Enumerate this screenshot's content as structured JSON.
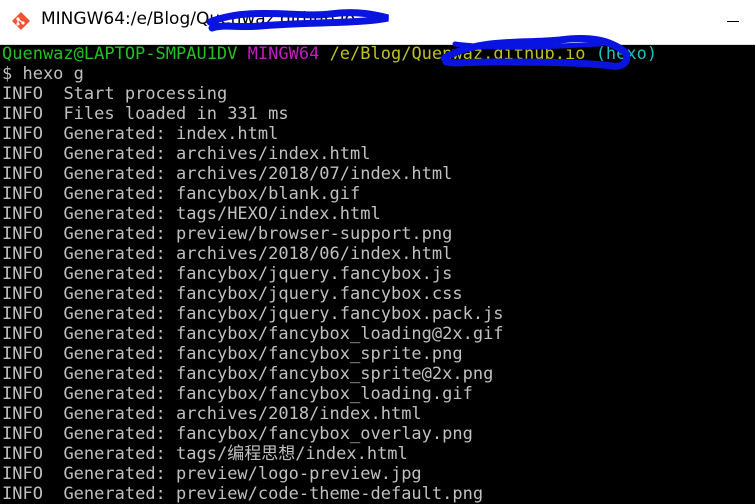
{
  "window": {
    "title": "MINGW64:/e/Blog/Quenwaz.github.io",
    "app_icon": "git-bash-icon",
    "minimize_icon": "minimize-icon"
  },
  "colors": {
    "background": "#000000",
    "prompt_user": "#21c11f",
    "prompt_env": "#c11bc1",
    "prompt_path": "#c0c021",
    "prompt_branch": "#21c0c0",
    "output_text": "#c0c0c0",
    "redaction": "#0a14e0"
  },
  "prompt": {
    "user_host": "Quenwaz@LAPTOP-SMPAU1DV",
    "env": "MINGW64",
    "path": "/e/Blog/Quenwaz.github.io",
    "branch": "(hexo)"
  },
  "command": "$ hexo g",
  "log": [
    {
      "level": "INFO",
      "message": "Start processing"
    },
    {
      "level": "INFO",
      "message": "Files loaded in 331 ms"
    },
    {
      "level": "INFO",
      "message": "Generated: index.html"
    },
    {
      "level": "INFO",
      "message": "Generated: archives/index.html"
    },
    {
      "level": "INFO",
      "message": "Generated: archives/2018/07/index.html"
    },
    {
      "level": "INFO",
      "message": "Generated: fancybox/blank.gif"
    },
    {
      "level": "INFO",
      "message": "Generated: tags/HEXO/index.html"
    },
    {
      "level": "INFO",
      "message": "Generated: preview/browser-support.png"
    },
    {
      "level": "INFO",
      "message": "Generated: archives/2018/06/index.html"
    },
    {
      "level": "INFO",
      "message": "Generated: fancybox/jquery.fancybox.js"
    },
    {
      "level": "INFO",
      "message": "Generated: fancybox/jquery.fancybox.css"
    },
    {
      "level": "INFO",
      "message": "Generated: fancybox/jquery.fancybox.pack.js"
    },
    {
      "level": "INFO",
      "message": "Generated: fancybox/fancybox_loading@2x.gif"
    },
    {
      "level": "INFO",
      "message": "Generated: fancybox/fancybox_sprite.png"
    },
    {
      "level": "INFO",
      "message": "Generated: fancybox/fancybox_sprite@2x.png"
    },
    {
      "level": "INFO",
      "message": "Generated: fancybox/fancybox_loading.gif"
    },
    {
      "level": "INFO",
      "message": "Generated: archives/2018/index.html"
    },
    {
      "level": "INFO",
      "message": "Generated: fancybox/fancybox_overlay.png"
    },
    {
      "level": "INFO",
      "message": "Generated: tags/编程思想/index.html"
    },
    {
      "level": "INFO",
      "message": "Generated: preview/logo-preview.jpg"
    },
    {
      "level": "INFO",
      "message": "Generated: preview/code-theme-default.png"
    }
  ]
}
